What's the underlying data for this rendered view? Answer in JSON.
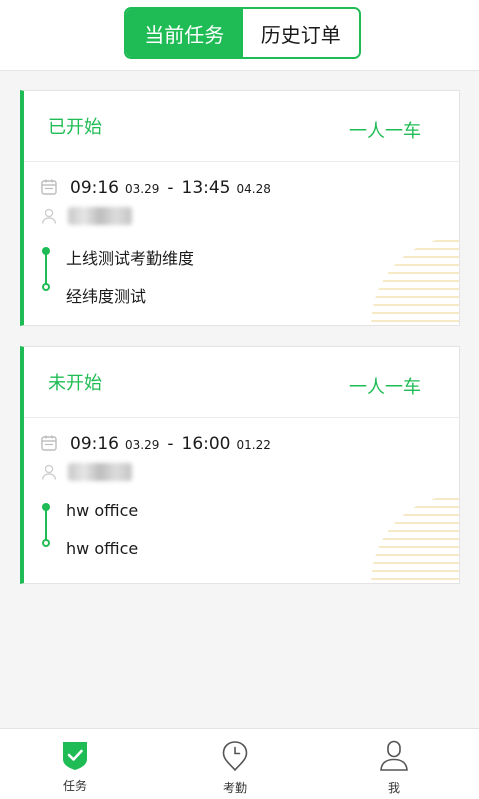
{
  "tabs": {
    "current": "当前任务",
    "history": "历史订单"
  },
  "tasks": [
    {
      "status": "已开始",
      "mode": "一人一车",
      "start_time": "09:16",
      "start_date": "03.29",
      "separator": "-",
      "end_time": "13:45",
      "end_date": "04.28",
      "from": "上线测试考勤维度",
      "to": "经纬度测试"
    },
    {
      "status": "未开始",
      "mode": "一人一车",
      "start_time": "09:16",
      "start_date": "03.29",
      "separator": "-",
      "end_time": "16:00",
      "end_date": "01.22",
      "from": "hw office",
      "to": "hw office"
    }
  ],
  "bottom_nav": {
    "tasks": "任务",
    "attendance": "考勤",
    "me": "我"
  },
  "colors": {
    "accent": "#1fbc55",
    "deco": "#f3e3b3"
  },
  "icons": [
    "calendar-icon",
    "user-icon",
    "check-shield-icon",
    "clock-pin-icon",
    "person-icon"
  ]
}
